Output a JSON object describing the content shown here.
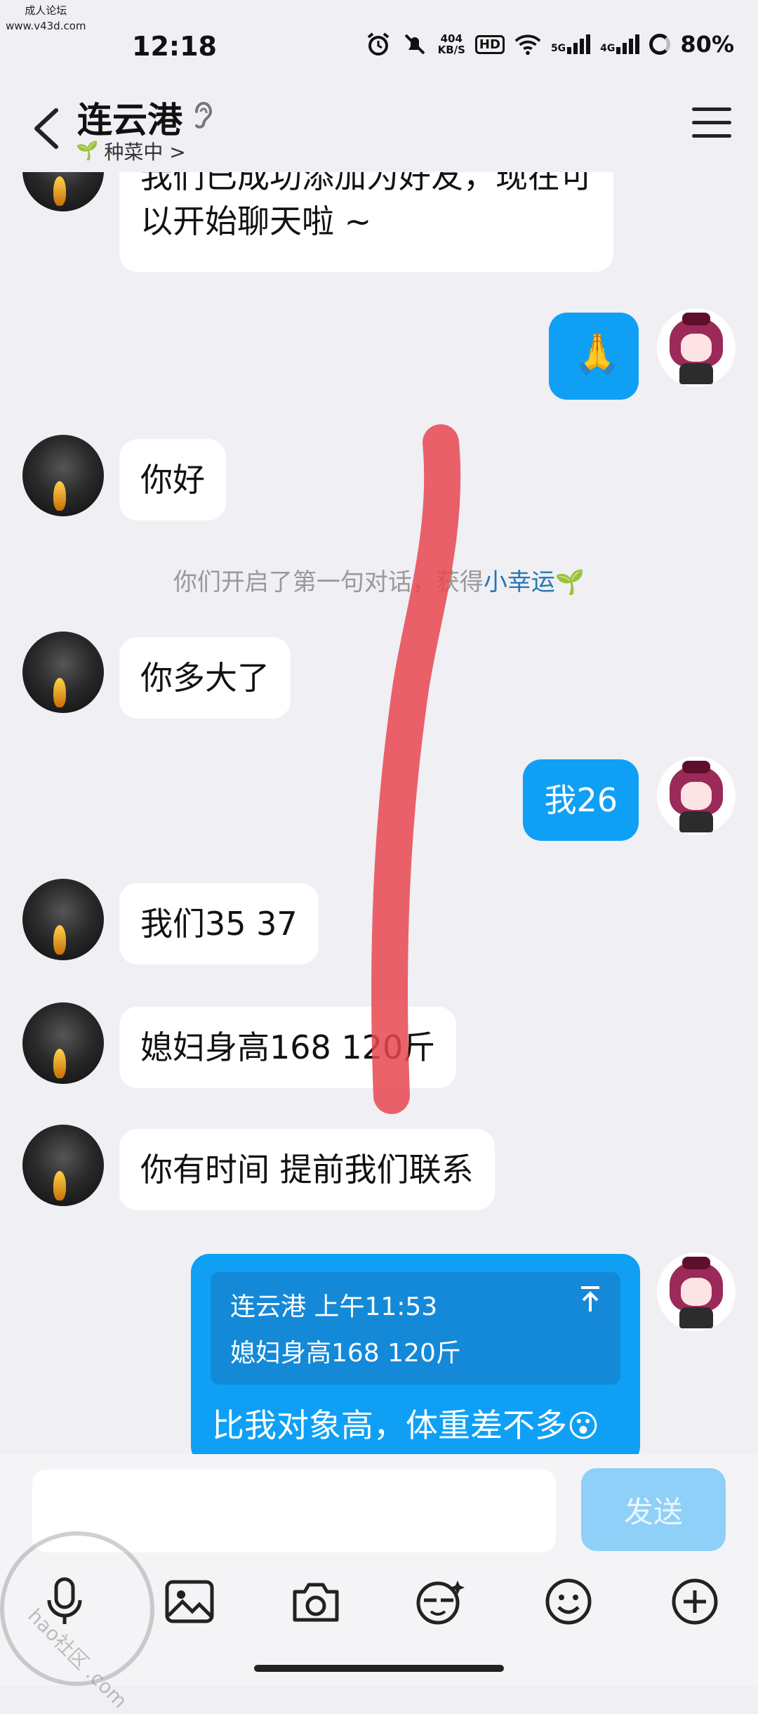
{
  "watermark": {
    "line1": "成人论坛",
    "line2": "www.v43d.com",
    "corner": "hao社区 .com"
  },
  "status": {
    "time": "12:18",
    "netspeed_value": "404",
    "netspeed_unit": "KB/S",
    "hd": "HD",
    "sig1": "5G",
    "sig2": "4G",
    "battery": "80%"
  },
  "header": {
    "title": "连云港",
    "subtitle": "种菜中 >"
  },
  "messages": [
    {
      "side": "in",
      "text_line1": "我们已成功添加为好友，现在可",
      "text_line2": "以开始聊天啦 ~"
    },
    {
      "side": "out",
      "emoji": "🙏"
    },
    {
      "side": "in",
      "text": "你好"
    },
    {
      "side": "in",
      "text": "你多大了"
    },
    {
      "side": "out",
      "text": "我26"
    },
    {
      "side": "in",
      "text": "我们35  37"
    },
    {
      "side": "in",
      "text": "媳妇身高168  120斤"
    },
    {
      "side": "in",
      "text": "你有时间 提前我们联系"
    }
  ],
  "system_notice": {
    "prefix": "你们开启了第一句对话，获得",
    "highlight": "小幸运"
  },
  "quote": {
    "meta": "连云港 上午11:53",
    "text": "媳妇身高168  120斤",
    "reply": "比我对象高，体重差不多"
  },
  "input": {
    "placeholder": "",
    "send_label": "发送"
  },
  "colors": {
    "outgoing": "#0fa0f5",
    "send_disabled": "#8fd0f8",
    "red_mark": "#e8464f"
  }
}
